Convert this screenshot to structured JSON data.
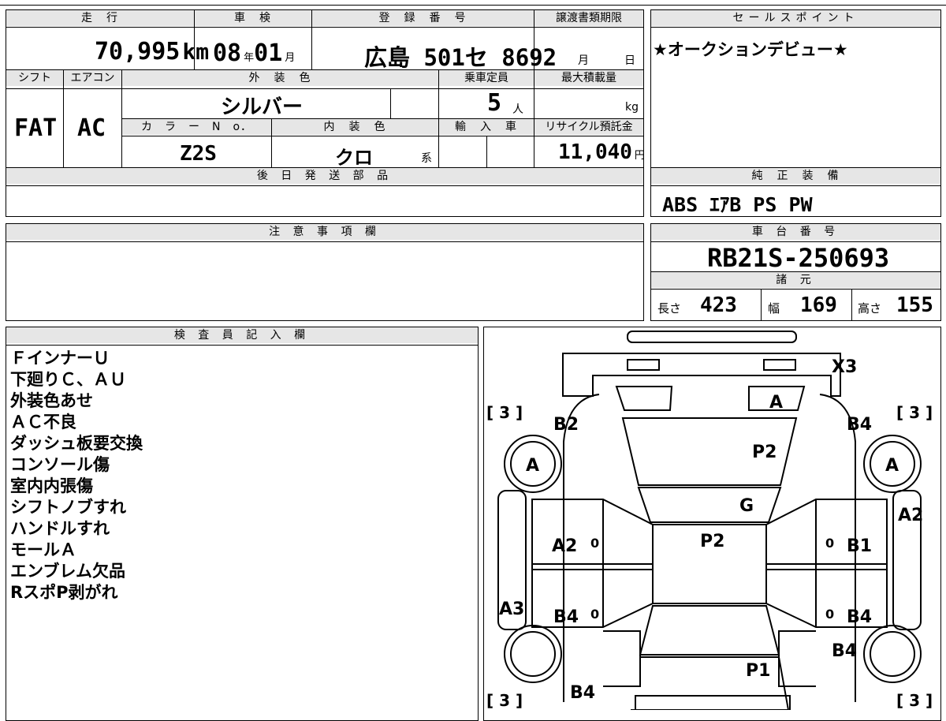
{
  "vehicle": {
    "mileage_label": "走　行",
    "mileage_value": "70,995",
    "mileage_unit": "km",
    "shaken_label": "車　検",
    "shaken_year": "08",
    "shaken_year_unit": "年",
    "shaken_month": "01",
    "shaken_month_unit": "月",
    "registration_label": "登　録　番　号",
    "registration_value": "広島 501セ 8692",
    "transfer_label": "譲渡書類期限",
    "transfer_month_unit": "月",
    "transfer_day_unit": "日",
    "shift_label": "シフト",
    "shift_value": "FAT",
    "ac_label": "エアコン",
    "ac_value": "AC",
    "exterior_label": "外　装　色",
    "exterior_value": "シルバー",
    "capacity_label": "乗車定員",
    "capacity_value": "5",
    "capacity_unit": "人",
    "load_label": "最大積載量",
    "load_unit": "kg",
    "color_no_label": "カ　ラ　ー　N　o．",
    "color_no_value": "Z2S",
    "interior_label": "内　装　色",
    "interior_value": "クロ",
    "interior_unit": "系",
    "import_label": "輸　入　車",
    "recycle_label": "リサイクル預託金",
    "recycle_value": "11,040",
    "recycle_unit": "円",
    "parts_label": "後 日 発 送 部 品"
  },
  "sales_point": {
    "label": "セールスポイント",
    "text": "★オークションデビュー★"
  },
  "equipment": {
    "label": "純　正　装　備",
    "text": "ABS  ｴｱB  PS  PW"
  },
  "caution": {
    "label": "注 意 事 項 欄"
  },
  "chassis": {
    "label": "車 台 番 号",
    "value": "RB21S-250693",
    "spec_label": "諸 元",
    "length_label": "長さ",
    "length_value": "423",
    "width_label": "幅",
    "width_value": "169",
    "height_label": "高さ",
    "height_value": "155"
  },
  "inspector": {
    "label": "検 査 員 記 入 欄",
    "notes": [
      "ＦインナーＵ",
      "下廻りＣ、ＡＵ",
      "外装色あせ",
      "ＡＣ不良",
      "ダッシュ板要交換",
      "コンソール傷",
      "室内内張傷",
      "シフトノブすれ",
      "ハンドルすれ",
      "モールＡ",
      "エンブレム欠品",
      "RスポP剥がれ"
    ]
  },
  "diagram": {
    "marks": {
      "x3": "X3",
      "a_windshield": "A",
      "p2_hood": "P2",
      "g_windshield": "G",
      "p2_roof": "P2",
      "p1_rear": "P1",
      "b2_front_left": "B2",
      "b4_front_right": "B4",
      "a_wheel_fl": "A",
      "a_wheel_fr": "A",
      "a2_left_door": "A2",
      "b1_right_door": "B1",
      "a2_right_fender": "A2",
      "a3_left_sill": "A3",
      "b4_left_rear_door": "B4",
      "b4_right_rear_door": "B4",
      "b4_right_quarter": "B4",
      "b4_rear_left": "B4",
      "tire_fl": "[ 3 ]",
      "tire_fr": "[ 3 ]",
      "tire_rl": "[ 3 ]",
      "tire_rr": "[ 3 ]",
      "zero1": "0",
      "zero2": "0",
      "zero3": "0",
      "zero4": "0"
    }
  }
}
